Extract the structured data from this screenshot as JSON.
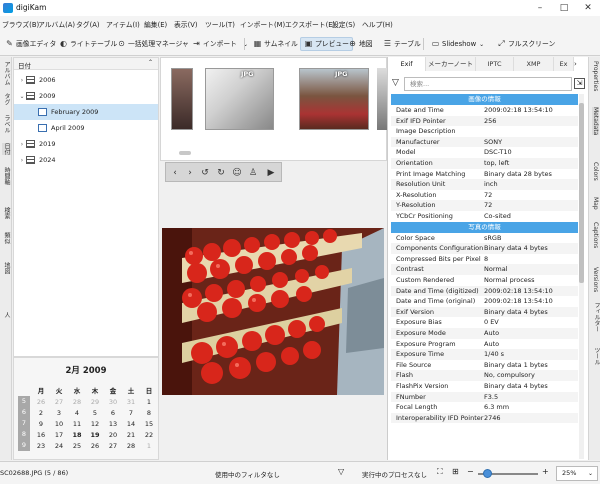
{
  "window": {
    "title": "digiKam"
  },
  "menu": [
    "ブラウズ(B)",
    "アルバム(A)",
    "タグ(A)",
    "アイテム(I)",
    "編集(E)",
    "表示(V)",
    "ツール(T)",
    "インポート(M)",
    "エクスポート(E)",
    "設定(S)",
    "ヘルプ(H)"
  ],
  "toolbar": {
    "image_editor": "画像エディタ",
    "light_table": "ライトテーブル",
    "batch_queue": "一括処理マネージャ",
    "import": "インポート",
    "thumbnails": "サムネイル",
    "preview": "プレビュー",
    "map": "地図",
    "table": "テーブル",
    "slideshow": "Slideshow",
    "fullscreen": "フルスクリーン"
  },
  "left_tabs": [
    "アルバム",
    "タグ",
    "ラベル",
    "日付",
    "時間軸",
    "検索",
    "類似",
    "地図",
    "人"
  ],
  "tree": {
    "header": "日付",
    "items": [
      {
        "label": "2006",
        "level": 0,
        "expanded": false,
        "selected": false
      },
      {
        "label": "2009",
        "level": 0,
        "expanded": true,
        "selected": false
      },
      {
        "label": "February 2009",
        "level": 1,
        "expanded": false,
        "selected": true
      },
      {
        "label": "April 2009",
        "level": 1,
        "expanded": false,
        "selected": false
      },
      {
        "label": "2019",
        "level": 0,
        "expanded": false,
        "selected": false
      },
      {
        "label": "2024",
        "level": 0,
        "expanded": false,
        "selected": false
      }
    ]
  },
  "calendar": {
    "title": "2月 2009",
    "days_of_week": [
      "月",
      "火",
      "水",
      "木",
      "金",
      "土",
      "日"
    ],
    "weeks": [
      {
        "week": "5",
        "days": [
          "26",
          "27",
          "28",
          "29",
          "30",
          "31",
          "1"
        ],
        "current_from": 6,
        "current_to": 6
      },
      {
        "week": "6",
        "days": [
          "2",
          "3",
          "4",
          "5",
          "6",
          "7",
          "8"
        ],
        "current_from": 0,
        "current_to": 6
      },
      {
        "week": "7",
        "days": [
          "9",
          "10",
          "11",
          "12",
          "13",
          "14",
          "15"
        ],
        "current_from": 0,
        "current_to": 6
      },
      {
        "week": "8",
        "days": [
          "16",
          "17",
          "18",
          "19",
          "20",
          "21",
          "22"
        ],
        "current_from": 0,
        "current_to": 6
      },
      {
        "week": "9",
        "days": [
          "23",
          "24",
          "25",
          "26",
          "27",
          "28",
          "1"
        ],
        "current_from": 0,
        "current_to": 5
      }
    ],
    "bold_days": [
      "18",
      "19"
    ]
  },
  "thumbnails": {
    "tags": [
      "JPG",
      "JPG"
    ]
  },
  "right_panel": {
    "tabs": [
      "Exif",
      "メーカーノート",
      "IPTC",
      "XMP",
      "Ex"
    ],
    "search_placeholder": "検索...",
    "sections": [
      {
        "title": "画像の情報",
        "rows": [
          [
            "Date and Time",
            "2009:02:18 13:54:10"
          ],
          [
            "Exif IFD Pointer",
            "256"
          ],
          [
            "Image Description",
            ""
          ],
          [
            "Manufacturer",
            "SONY"
          ],
          [
            "Model",
            "DSC-T10"
          ],
          [
            "Orientation",
            "top, left"
          ],
          [
            "Print Image Matching",
            "Binary data 28 bytes"
          ],
          [
            "Resolution Unit",
            "inch"
          ],
          [
            "X-Resolution",
            "72"
          ],
          [
            "Y-Resolution",
            "72"
          ],
          [
            "YCbCr Positioning",
            "Co-sited"
          ]
        ]
      },
      {
        "title": "写真の情報",
        "rows": [
          [
            "Color Space",
            "sRGB"
          ],
          [
            "Components Configuration",
            "Binary data 4 bytes"
          ],
          [
            "Compressed Bits per Pixel",
            "8"
          ],
          [
            "Contrast",
            "Normal"
          ],
          [
            "Custom Rendered",
            "Normal process"
          ],
          [
            "Date and Time (digitized)",
            "2009:02:18 13:54:10"
          ],
          [
            "Date and Time (original)",
            "2009:02:18 13:54:10"
          ],
          [
            "Exif Version",
            "Binary data 4 bytes"
          ],
          [
            "Exposure Bias",
            "0 EV"
          ],
          [
            "Exposure Mode",
            "Auto"
          ],
          [
            "Exposure Program",
            "Auto"
          ],
          [
            "Exposure Time",
            "1/40 s"
          ],
          [
            "File Source",
            "Binary data 1 bytes"
          ],
          [
            "Flash",
            "No, compulsory"
          ],
          [
            "FlashPix Version",
            "Binary data 4 bytes"
          ],
          [
            "FNumber",
            "F3.5"
          ],
          [
            "Focal Length",
            "6.3 mm"
          ],
          [
            "Interoperability IFD Pointer",
            "2746"
          ]
        ]
      }
    ]
  },
  "right_strip_tabs": [
    "Properties",
    "Metadata",
    "Colors",
    "Map",
    "Captions",
    "Versions",
    "フィルター",
    "ツール"
  ],
  "status": {
    "filename": "SC02688.JPG (5 / 86)",
    "filter": "使用中のフィルタなし",
    "process": "実行中のプロセスなし",
    "zoom": "25%"
  },
  "colors": {
    "accent": "#49a4e6",
    "selection": "#cce4f7"
  }
}
